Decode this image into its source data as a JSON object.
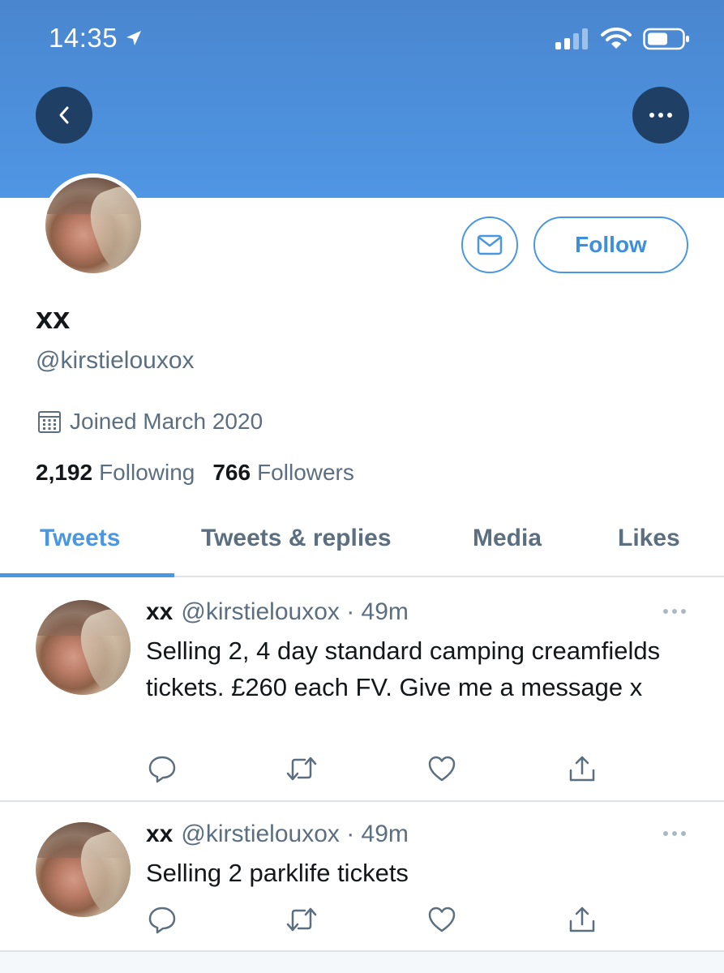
{
  "status_bar": {
    "time": "14:35",
    "icons": [
      "location-arrow-icon",
      "cellular-signal-icon",
      "wifi-icon",
      "battery-icon"
    ]
  },
  "colors": {
    "banner": "#4f96e4",
    "accent": "#4a97e1",
    "nav_button_bg": "#1f3f64",
    "secondary_text": "#5b6f80"
  },
  "header": {
    "back_icon": "chevron-left-icon",
    "more_icon": "more-horizontal-icon"
  },
  "profile": {
    "display_name": "xx",
    "handle": "@kirstielouxox",
    "joined": "Joined March 2020",
    "following_count": "2,192",
    "following_label": "Following",
    "followers_count": "766",
    "followers_label": "Followers",
    "message_icon": "envelope-icon",
    "follow_label": "Follow"
  },
  "tabs": [
    {
      "label": "Tweets",
      "active": true
    },
    {
      "label": "Tweets & replies",
      "active": false
    },
    {
      "label": "Media",
      "active": false
    },
    {
      "label": "Likes",
      "active": false
    }
  ],
  "tweets": [
    {
      "name": "xx",
      "handle": "@kirstielouxox",
      "time": "· 49m",
      "text": "Selling 2, 4 day standard camping creamfields tickets. £260 each FV. Give me a message x"
    },
    {
      "name": "xx",
      "handle": "@kirstielouxox",
      "time": "· 49m",
      "text": "Selling 2 parklife tickets"
    }
  ]
}
